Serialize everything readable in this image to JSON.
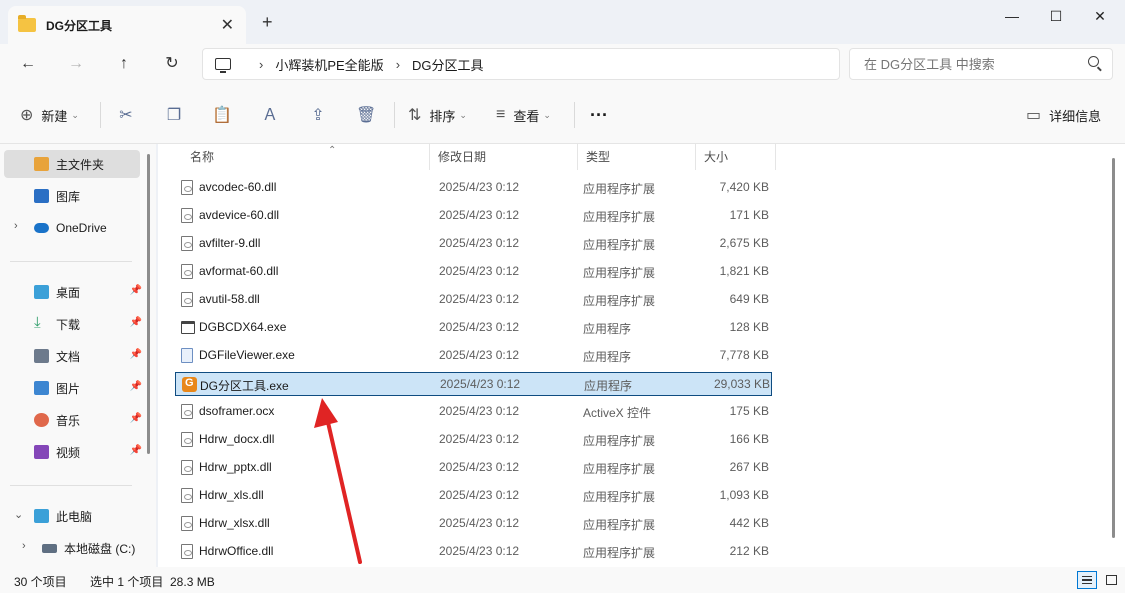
{
  "window": {
    "tab_title": "DG分区工具",
    "new_tab_icon": "plus-icon",
    "controls": [
      "minimize",
      "maximize",
      "close"
    ]
  },
  "address": {
    "segments": [
      "小辉装机PE全能版",
      "DG分区工具"
    ],
    "search_placeholder": "在 DG分区工具 中搜索"
  },
  "toolbar": {
    "new_label": "新建",
    "sort_label": "排序",
    "view_label": "查看",
    "more_label": "···",
    "details_label": "详细信息"
  },
  "sidebar": {
    "items": [
      {
        "label": "主文件夹",
        "icon": "home-icon",
        "color": "#e8a33b"
      },
      {
        "label": "图库",
        "icon": "gallery-icon",
        "color": "#2b6fc4"
      },
      {
        "label": "OneDrive",
        "icon": "cloud-icon",
        "color": "#1a73c9"
      },
      {
        "label": "桌面",
        "icon": "desktop-icon",
        "color": "#3ba0d8"
      },
      {
        "label": "下载",
        "icon": "download-icon",
        "color": "#2e9e6a"
      },
      {
        "label": "文档",
        "icon": "document-icon",
        "color": "#6d7a8c"
      },
      {
        "label": "图片",
        "icon": "picture-icon",
        "color": "#3d86d1"
      },
      {
        "label": "音乐",
        "icon": "music-icon",
        "color": "#e0684b"
      },
      {
        "label": "视频",
        "icon": "video-icon",
        "color": "#8446b8"
      },
      {
        "label": "此电脑",
        "icon": "pc-icon",
        "color": "#3ba0d8"
      },
      {
        "label": "本地磁盘 (C:)",
        "icon": "drive-icon",
        "color": "#5f6f82"
      }
    ]
  },
  "columns": {
    "name": "名称",
    "date": "修改日期",
    "type": "类型",
    "size": "大小"
  },
  "files": [
    {
      "name": "avcodec-60.dll",
      "date": "2025/4/23 0:12",
      "type": "应用程序扩展",
      "size": "7,420 KB",
      "icon": "dll"
    },
    {
      "name": "avdevice-60.dll",
      "date": "2025/4/23 0:12",
      "type": "应用程序扩展",
      "size": "171 KB",
      "icon": "dll"
    },
    {
      "name": "avfilter-9.dll",
      "date": "2025/4/23 0:12",
      "type": "应用程序扩展",
      "size": "2,675 KB",
      "icon": "dll"
    },
    {
      "name": "avformat-60.dll",
      "date": "2025/4/23 0:12",
      "type": "应用程序扩展",
      "size": "1,821 KB",
      "icon": "dll"
    },
    {
      "name": "avutil-58.dll",
      "date": "2025/4/23 0:12",
      "type": "应用程序扩展",
      "size": "649 KB",
      "icon": "dll"
    },
    {
      "name": "DGBCDX64.exe",
      "date": "2025/4/23 0:12",
      "type": "应用程序",
      "size": "128 KB",
      "icon": "exe-win"
    },
    {
      "name": "DGFileViewer.exe",
      "date": "2025/4/23 0:12",
      "type": "应用程序",
      "size": "7,778 KB",
      "icon": "exe-viewer"
    },
    {
      "name": "DG分区工具.exe",
      "date": "2025/4/23 0:12",
      "type": "应用程序",
      "size": "29,033 KB",
      "icon": "exe-dg",
      "selected": true
    },
    {
      "name": "dsoframer.ocx",
      "date": "2025/4/23 0:12",
      "type": "ActiveX 控件",
      "size": "175 KB",
      "icon": "dll"
    },
    {
      "name": "Hdrw_docx.dll",
      "date": "2025/4/23 0:12",
      "type": "应用程序扩展",
      "size": "166 KB",
      "icon": "dll"
    },
    {
      "name": "Hdrw_pptx.dll",
      "date": "2025/4/23 0:12",
      "type": "应用程序扩展",
      "size": "267 KB",
      "icon": "dll"
    },
    {
      "name": "Hdrw_xls.dll",
      "date": "2025/4/23 0:12",
      "type": "应用程序扩展",
      "size": "1,093 KB",
      "icon": "dll"
    },
    {
      "name": "Hdrw_xlsx.dll",
      "date": "2025/4/23 0:12",
      "type": "应用程序扩展",
      "size": "442 KB",
      "icon": "dll"
    },
    {
      "name": "HdrwOffice.dll",
      "date": "2025/4/23 0:12",
      "type": "应用程序扩展",
      "size": "212 KB",
      "icon": "dll"
    }
  ],
  "status": {
    "count": "30 个项目",
    "selection": "选中 1 个项目  28.3 MB"
  },
  "annotation": {
    "arrow_color": "#e02424"
  }
}
